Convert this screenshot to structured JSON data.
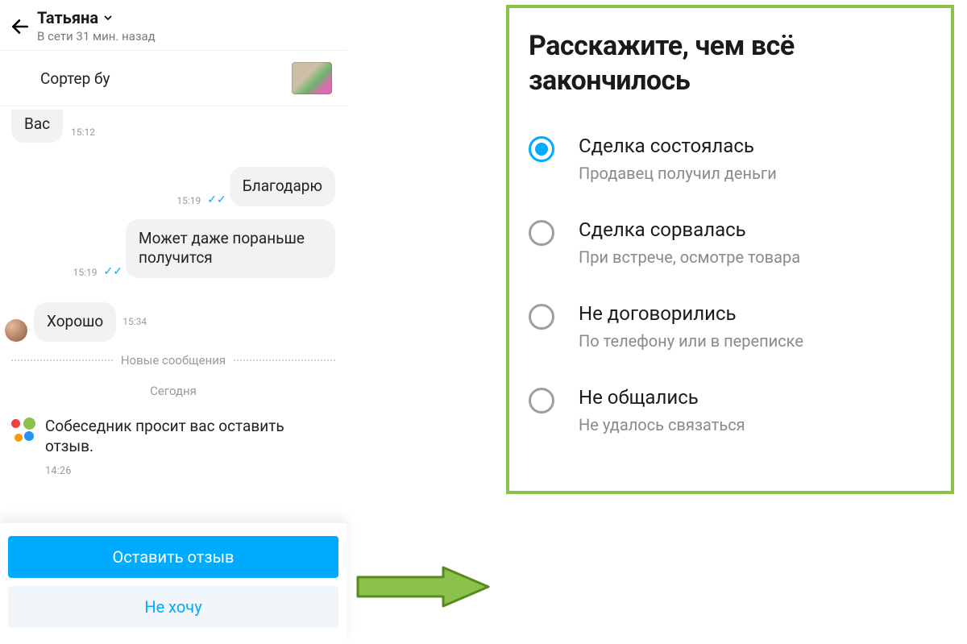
{
  "chat": {
    "contact_name": "Татьяна",
    "status": "В сети 31 мин. назад",
    "listing_title": "Сортер бу",
    "clipped_msg": {
      "text": "Вас",
      "time": "15:12"
    },
    "out_msg_1": {
      "text": "Благодарю",
      "time": "15:19"
    },
    "out_msg_2": {
      "text": "Может даже пораньше получится",
      "time": "15:19"
    },
    "in_msg_1": {
      "text": "Хорошо",
      "time": "15:34"
    },
    "divider_new": "Новые сообщения",
    "date_label": "Сегодня",
    "system_msg": {
      "text": "Собеседник просит вас оставить отзыв.",
      "time": "14:26"
    },
    "btn_primary": "Оставить отзыв",
    "btn_secondary": "Не хочу"
  },
  "right": {
    "title": "Расскажите, чем всё закончилось",
    "options": [
      {
        "title": "Сделка состоялась",
        "sub": "Продавец получил деньги",
        "selected": true
      },
      {
        "title": "Сделка сорвалась",
        "sub": "При встрече, осмотре товара",
        "selected": false
      },
      {
        "title": "Не договорились",
        "sub": "По телефону или в переписке",
        "selected": false
      },
      {
        "title": "Не общались",
        "sub": "Не удалось связаться",
        "selected": false
      }
    ]
  },
  "colors": {
    "accent": "#00aaff",
    "highlight": "#8bc34a"
  }
}
